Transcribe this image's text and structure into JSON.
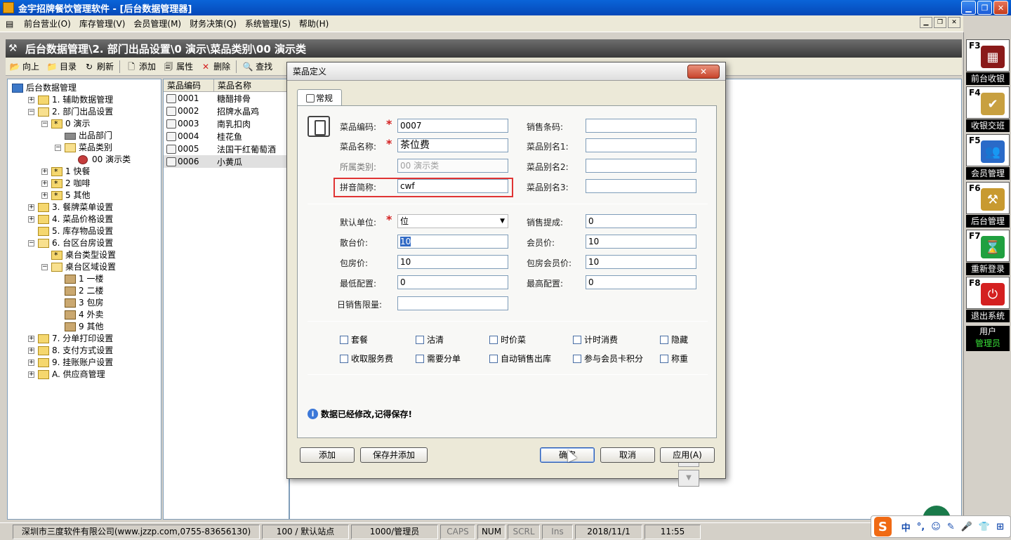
{
  "window": {
    "title": "金宇招牌餐饮管理软件 - [后台数据管理器]",
    "min": "▁",
    "restore": "❐",
    "close": "✕"
  },
  "menubar": {
    "items": [
      "前台营业(O)",
      "库存管理(V)",
      "会员管理(M)",
      "财务决策(Q)",
      "系统管理(S)",
      "帮助(H)"
    ]
  },
  "doc": {
    "breadcrumb": "后台数据管理\\2. 部门出品设置\\0 演示\\菜品类别\\00 演示类"
  },
  "toolbar": {
    "up": "向上",
    "catalog": "目录",
    "refresh": "刷新",
    "add": "添加",
    "props": "属性",
    "delete": "删除",
    "find": "查找"
  },
  "tree": [
    {
      "label": "后台数据管理",
      "level": 0,
      "exp": "",
      "icon": "db"
    },
    {
      "label": "1. 辅助数据管理",
      "level": 1,
      "exp": "+",
      "icon": "folder"
    },
    {
      "label": "2. 部门出品设置",
      "level": 1,
      "exp": "−",
      "icon": "open"
    },
    {
      "label": "0 演示",
      "level": 2,
      "exp": "−",
      "icon": "star"
    },
    {
      "label": "出品部门",
      "level": 3,
      "exp": "",
      "icon": "util"
    },
    {
      "label": "菜品类别",
      "level": 3,
      "exp": "−",
      "icon": "open"
    },
    {
      "label": "00 演示类",
      "level": 4,
      "exp": "",
      "icon": "dish"
    },
    {
      "label": "1 快餐",
      "level": 2,
      "exp": "+",
      "icon": "star"
    },
    {
      "label": "2 咖啡",
      "level": 2,
      "exp": "+",
      "icon": "star"
    },
    {
      "label": "5 其他",
      "level": 2,
      "exp": "+",
      "icon": "star"
    },
    {
      "label": "3. 餐牌菜单设置",
      "level": 1,
      "exp": "+",
      "icon": "folder"
    },
    {
      "label": "4. 菜品价格设置",
      "level": 1,
      "exp": "+",
      "icon": "folder"
    },
    {
      "label": "5. 库存物品设置",
      "level": 1,
      "exp": "",
      "icon": "folder"
    },
    {
      "label": "6. 台区台房设置",
      "level": 1,
      "exp": "−",
      "icon": "open"
    },
    {
      "label": "桌台类型设置",
      "level": 2,
      "exp": "",
      "icon": "star"
    },
    {
      "label": "桌台区域设置",
      "level": 2,
      "exp": "−",
      "icon": "open"
    },
    {
      "label": "1 一楼",
      "level": 3,
      "exp": "",
      "icon": "room"
    },
    {
      "label": "2 二楼",
      "level": 3,
      "exp": "",
      "icon": "room"
    },
    {
      "label": "3 包房",
      "level": 3,
      "exp": "",
      "icon": "room"
    },
    {
      "label": "4 外卖",
      "level": 3,
      "exp": "",
      "icon": "room"
    },
    {
      "label": "9 其他",
      "level": 3,
      "exp": "",
      "icon": "room"
    },
    {
      "label": "7. 分单打印设置",
      "level": 1,
      "exp": "+",
      "icon": "folder"
    },
    {
      "label": "8. 支付方式设置",
      "level": 1,
      "exp": "+",
      "icon": "folder"
    },
    {
      "label": "9. 挂账账户设置",
      "level": 1,
      "exp": "+",
      "icon": "folder"
    },
    {
      "label": "A. 供应商管理",
      "level": 1,
      "exp": "+",
      "icon": "folder"
    }
  ],
  "list": {
    "headers": [
      "菜品编码",
      "菜品名称"
    ],
    "rows": [
      [
        "0001",
        "糖醋排骨"
      ],
      [
        "0002",
        "招牌水晶鸡"
      ],
      [
        "0003",
        "南乳扣肉"
      ],
      [
        "0004",
        "桂花鱼"
      ],
      [
        "0005",
        "法国干红葡萄酒"
      ],
      [
        "0006",
        "小黄瓜"
      ]
    ]
  },
  "rpanel": {
    "keys": [
      {
        "key": "F3",
        "label": "前台收银",
        "color": "#8a1a1a",
        "glyph": "▦"
      },
      {
        "key": "F4",
        "label": "收银交班",
        "color": "#c8a040",
        "glyph": "✔"
      },
      {
        "key": "F5",
        "label": "会员管理",
        "color": "#2a6ac8",
        "glyph": "👥"
      },
      {
        "key": "F6",
        "label": "后台管理",
        "color": "#c89a30",
        "glyph": "⚒"
      },
      {
        "key": "F7",
        "label": "重新登录",
        "color": "#20a040",
        "glyph": "⌛"
      },
      {
        "key": "F8",
        "label": "退出系统",
        "color": "#d42020",
        "glyph": "⏻"
      }
    ],
    "user_label": "用户",
    "user_name": "管理员"
  },
  "dialog": {
    "title": "菜品定义",
    "close": "✕",
    "tab": "常规",
    "fields": {
      "code_label": "菜品编码:",
      "code": "0007",
      "name_label": "菜品名称:",
      "name": "茶位费",
      "category_label": "所属类别:",
      "category": "00 演示类",
      "pinyin_label": "拼音简称:",
      "pinyin": "cwf",
      "barcode_label": "销售条码:",
      "barcode": "",
      "alias1_label": "菜品别名1:",
      "alias1": "",
      "alias2_label": "菜品别名2:",
      "alias2": "",
      "alias3_label": "菜品别名3:",
      "alias3": "",
      "unit_label": "默认单位:",
      "unit": "位",
      "commission_label": "销售提成:",
      "commission": "0",
      "hall_label": "散台价:",
      "hall": "10",
      "member_label": "会员价:",
      "member": "10",
      "room_label": "包房价:",
      "room": "10",
      "room_member_label": "包房会员价:",
      "room_member": "10",
      "min_label": "最低配置:",
      "min": "0",
      "max_label": "最高配置:",
      "max": "0",
      "daily_label": "日销售限量:",
      "daily": ""
    },
    "checks": [
      "套餐",
      "沽清",
      "时价菜",
      "计时消费",
      "隐藏",
      "收取服务费",
      "需要分单",
      "自动销售出库",
      "参与会员卡积分",
      "称重"
    ],
    "message": "数据已经修改,记得保存!",
    "up_arrow": "▲",
    "down_arrow": "▼",
    "buttons": {
      "add": "添加",
      "save_add": "保存并添加",
      "ok": "确定",
      "cancel": "取消",
      "apply": "应用(A)"
    }
  },
  "status": {
    "company": "深圳市三度软件有限公司(www.jzzp.com,0755-83656130)",
    "station": "100 / 默认站点",
    "operator": "1000/管理员",
    "caps": "CAPS",
    "num": "NUM",
    "scrl": "SCRL",
    "ins": "Ins",
    "date": "2018/11/1",
    "time": "11:55"
  },
  "ime": {
    "logo": "S",
    "items": [
      "中",
      "°,",
      "☺",
      "✎",
      "🎤",
      "👕",
      "⊞"
    ]
  }
}
